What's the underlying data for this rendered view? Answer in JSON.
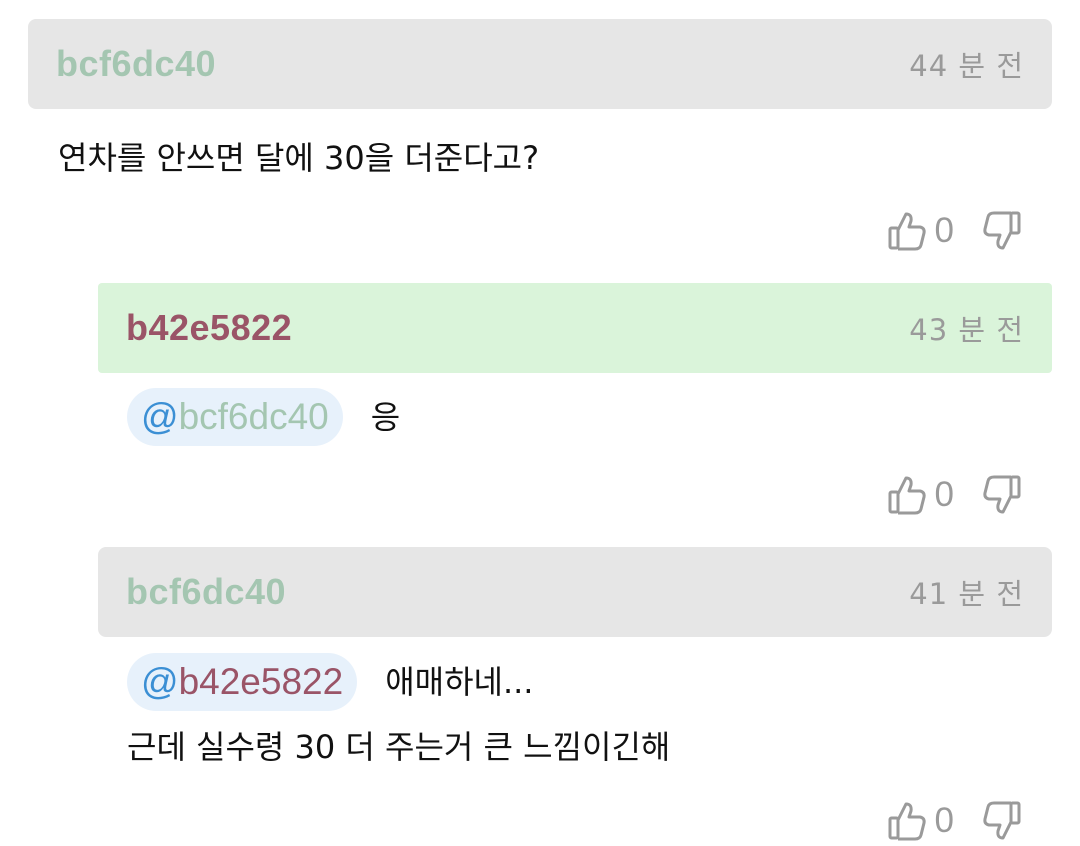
{
  "colors": {
    "header_gray": "#e6e6e6",
    "header_green": "#daf4da",
    "user_gray_green": "#a4c6b1",
    "user_maroon": "#9a5467",
    "mention_bg": "#e7f1fb",
    "mention_at": "#3b8fd4"
  },
  "comments": [
    {
      "user": "bcf6dc40",
      "time": "44 분 전",
      "lines": [
        "연차를 안쓰면 달에 30을 더준다고?"
      ],
      "likes": "0",
      "like_icon": "thumbs-up-icon",
      "dislike_icon": "thumbs-down-icon"
    },
    {
      "user": "b42e5822",
      "time": "43 분 전",
      "mention": {
        "at": "@",
        "name": "bcf6dc40"
      },
      "lines": [
        "응"
      ],
      "likes": "0",
      "like_icon": "thumbs-up-icon",
      "dislike_icon": "thumbs-down-icon"
    },
    {
      "user": "bcf6dc40",
      "time": "41 분 전",
      "mention": {
        "at": "@",
        "name": "b42e5822"
      },
      "lines": [
        "애매하네...",
        "근데 실수령 30 더 주는거 큰 느낌이긴해"
      ],
      "likes": "0",
      "like_icon": "thumbs-up-icon",
      "dislike_icon": "thumbs-down-icon"
    }
  ]
}
